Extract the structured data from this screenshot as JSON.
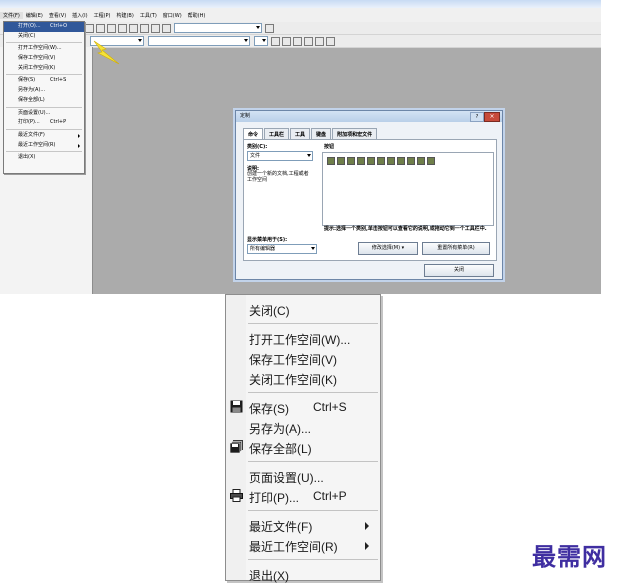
{
  "menubar": {
    "items": [
      "文件(F)",
      "编辑(E)",
      "查看(V)",
      "插入(I)",
      "工程(P)",
      "构建(B)",
      "工具(T)",
      "窗口(W)",
      "帮助(H)"
    ]
  },
  "small_file_menu": {
    "items": [
      {
        "label": "打开(O)...",
        "shortcut": "Ctrl+O",
        "highlighted": true
      },
      {
        "label": "关闭(C)"
      },
      {
        "sep": true
      },
      {
        "label": "打开工作空间(W)..."
      },
      {
        "label": "保存工作空间(V)"
      },
      {
        "label": "关闭工作空间(K)"
      },
      {
        "sep": true
      },
      {
        "label": "保存(S)",
        "shortcut": "Ctrl+S"
      },
      {
        "label": "另存为(A)..."
      },
      {
        "label": "保存全部(L)"
      },
      {
        "sep": true
      },
      {
        "label": "页面设置(U)..."
      },
      {
        "label": "打印(P)...",
        "shortcut": "Ctrl+P"
      },
      {
        "sep": true
      },
      {
        "label": "最近文件(F)",
        "submenu": true
      },
      {
        "label": "最近工作空间(R)",
        "submenu": true
      },
      {
        "sep": true
      },
      {
        "label": "退出(X)"
      }
    ]
  },
  "dialog": {
    "title": "定制",
    "help_glyph": "?",
    "close_glyph": "×",
    "tabs": [
      "命令",
      "工具栏",
      "工具",
      "键盘",
      "附加项和宏文件"
    ],
    "category_label": "类别(C):",
    "category_value": "文件",
    "description_label": "说明:",
    "description_text": "创建一个新的文档,工程或者工作空间",
    "buttons_label": "按钮",
    "hint_text": "提示:选择一个类别,单击按钮可以查看它的说明,或拖动它到一个工具栏中.",
    "show_menu_label": "显示菜单用于(S):",
    "show_menu_value": "所有编辑器",
    "modify_selection_button": "修改选择(M) ▾",
    "reset_all_menus_button": "重置所有菜单(R)",
    "close_button": "关闭"
  },
  "file_menu": {
    "items": [
      {
        "label": "关闭(C)",
        "shortcut": "",
        "icon": "",
        "submenu": false
      },
      {
        "separator": true
      },
      {
        "label": "打开工作空间(W)...",
        "shortcut": "",
        "icon": "",
        "submenu": false
      },
      {
        "label": "保存工作空间(V)",
        "shortcut": "",
        "icon": "",
        "submenu": false
      },
      {
        "label": "关闭工作空间(K)",
        "shortcut": "",
        "icon": "",
        "submenu": false
      },
      {
        "separator": true
      },
      {
        "label": "保存(S)",
        "shortcut": "Ctrl+S",
        "icon": "save-icon",
        "submenu": false
      },
      {
        "label": "另存为(A)...",
        "shortcut": "",
        "icon": "",
        "submenu": false
      },
      {
        "label": "保存全部(L)",
        "shortcut": "",
        "icon": "save-all-icon",
        "submenu": false
      },
      {
        "separator": true
      },
      {
        "label": "页面设置(U)...",
        "shortcut": "",
        "icon": "",
        "submenu": false
      },
      {
        "label": "打印(P)...",
        "shortcut": "Ctrl+P",
        "icon": "print-icon",
        "submenu": false
      },
      {
        "separator": true
      },
      {
        "label": "最近文件(F)",
        "shortcut": "",
        "icon": "",
        "submenu": true
      },
      {
        "label": "最近工作空间(R)",
        "shortcut": "",
        "icon": "",
        "submenu": true
      },
      {
        "separator": true
      },
      {
        "label": "退出(X)",
        "shortcut": "",
        "icon": "",
        "submenu": false
      }
    ]
  },
  "watermark": "最需网"
}
